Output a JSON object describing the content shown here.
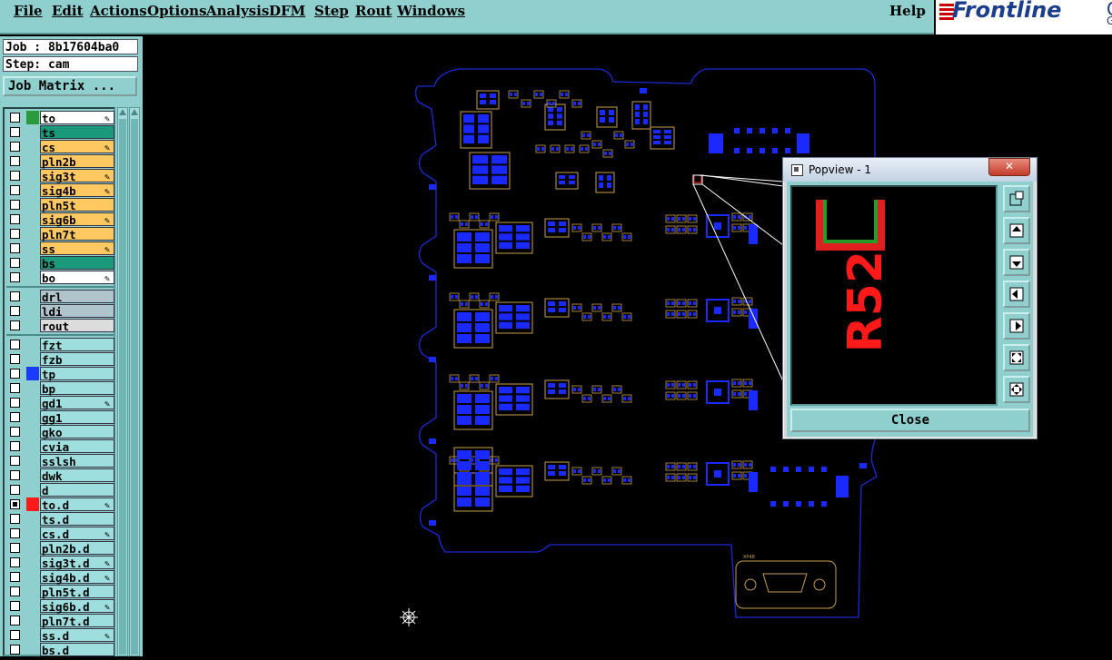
{
  "menu": {
    "items": [
      "File",
      "Edit",
      "Actions",
      "Options",
      "Analysis",
      "DFM",
      "Step",
      "Rout",
      "Windows"
    ],
    "help": "Help"
  },
  "logo": {
    "brand": "Frontline",
    "extra": "Ge",
    "extra2": "G"
  },
  "job": {
    "job_label": "Job : 8b17604ba0",
    "step_label": "Step: cam",
    "matrix_button": "Job Matrix ..."
  },
  "layers": [
    {
      "name": "to",
      "color": "#ffffff",
      "swatch": "#2a9a3a",
      "edit": true
    },
    {
      "name": "ts",
      "color": "#1a9a7a",
      "swatch": "",
      "edit": false
    },
    {
      "name": "cs",
      "color": "#ffc860",
      "swatch": "",
      "edit": true
    },
    {
      "name": "pln2b",
      "color": "#ffc860",
      "swatch": "",
      "edit": false
    },
    {
      "name": "sig3t",
      "color": "#ffc860",
      "swatch": "",
      "edit": true
    },
    {
      "name": "sig4b",
      "color": "#ffc860",
      "swatch": "",
      "edit": true
    },
    {
      "name": "pln5t",
      "color": "#ffc860",
      "swatch": "",
      "edit": false
    },
    {
      "name": "sig6b",
      "color": "#ffc860",
      "swatch": "",
      "edit": true
    },
    {
      "name": "pln7t",
      "color": "#ffc860",
      "swatch": "",
      "edit": false
    },
    {
      "name": "ss",
      "color": "#ffc860",
      "swatch": "",
      "edit": true
    },
    {
      "name": "bs",
      "color": "#1a9a7a",
      "swatch": "",
      "edit": false
    },
    {
      "name": "bo",
      "color": "#ffffff",
      "swatch": "",
      "edit": true
    },
    {
      "name": "drl",
      "color": "#b0c4cc",
      "swatch": "",
      "edit": false
    },
    {
      "name": "ldi",
      "color": "#b0c4cc",
      "swatch": "",
      "edit": false
    },
    {
      "name": "rout",
      "color": "#dcdcdc",
      "swatch": "",
      "edit": false
    },
    {
      "name": "fzt",
      "color": "#9fdede",
      "swatch": "",
      "edit": false
    },
    {
      "name": "fzb",
      "color": "#9fdede",
      "swatch": "",
      "edit": false
    },
    {
      "name": "tp",
      "color": "#9fdede",
      "swatch": "#1a3aff",
      "edit": false
    },
    {
      "name": "bp",
      "color": "#9fdede",
      "swatch": "",
      "edit": false
    },
    {
      "name": "gd1",
      "color": "#9fdede",
      "swatch": "",
      "edit": true
    },
    {
      "name": "gg1",
      "color": "#9fdede",
      "swatch": "",
      "edit": false
    },
    {
      "name": "gko",
      "color": "#9fdede",
      "swatch": "",
      "edit": false
    },
    {
      "name": "cvia",
      "color": "#9fdede",
      "swatch": "",
      "edit": false
    },
    {
      "name": "sslsh",
      "color": "#9fdede",
      "swatch": "",
      "edit": false
    },
    {
      "name": "dwk",
      "color": "#9fdede",
      "swatch": "",
      "edit": false
    },
    {
      "name": "d",
      "color": "#9fdede",
      "swatch": "",
      "edit": false
    },
    {
      "name": "to.d",
      "color": "#9fdede",
      "swatch": "#ff1a1a",
      "edit": true
    },
    {
      "name": "ts.d",
      "color": "#9fdede",
      "swatch": "",
      "edit": false
    },
    {
      "name": "cs.d",
      "color": "#9fdede",
      "swatch": "",
      "edit": true
    },
    {
      "name": "pln2b.d",
      "color": "#9fdede",
      "swatch": "",
      "edit": false
    },
    {
      "name": "sig3t.d",
      "color": "#9fdede",
      "swatch": "",
      "edit": true
    },
    {
      "name": "sig4b.d",
      "color": "#9fdede",
      "swatch": "",
      "edit": true
    },
    {
      "name": "pln5t.d",
      "color": "#9fdede",
      "swatch": "",
      "edit": false
    },
    {
      "name": "sig6b.d",
      "color": "#9fdede",
      "swatch": "",
      "edit": true
    },
    {
      "name": "pln7t.d",
      "color": "#9fdede",
      "swatch": "",
      "edit": false
    },
    {
      "name": "ss.d",
      "color": "#9fdede",
      "swatch": "",
      "edit": true
    },
    {
      "name": "bs.d",
      "color": "#9fdede",
      "swatch": "",
      "edit": false
    }
  ],
  "popview": {
    "title": "Popview - 1",
    "close_button": "Close",
    "zoom_ref": "R52"
  },
  "board": {
    "connector_ref": "XP48"
  },
  "colors": {
    "panel": "#8fd0cf",
    "outline": "#1a2ad8",
    "pad": "#1a2aff",
    "silk": "#c8a050",
    "ref": "#ff2020"
  }
}
